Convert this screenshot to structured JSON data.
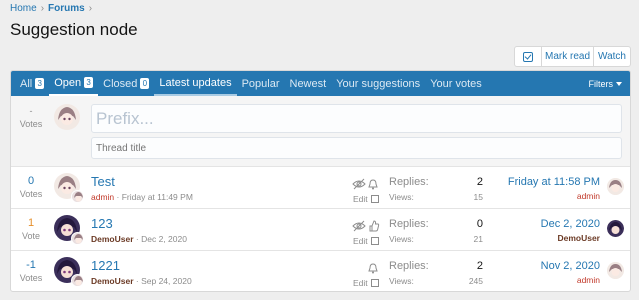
{
  "breadcrumb": {
    "home": "Home",
    "sep": "›",
    "current": "Forums",
    "trail": "›"
  },
  "page_title": "Suggestion node",
  "actions": {
    "mark_read": "Mark read",
    "watch": "Watch"
  },
  "tabs": [
    {
      "label": "All",
      "count": "3"
    },
    {
      "label": "Open",
      "count": "3"
    },
    {
      "label": "Closed",
      "count": "0"
    },
    {
      "label": "Latest updates"
    },
    {
      "label": "Popular"
    },
    {
      "label": "Newest"
    },
    {
      "label": "Your suggestions"
    },
    {
      "label": "Your votes"
    }
  ],
  "filters_label": "Filters",
  "quick_thread": {
    "votes_num": "-",
    "votes_label": "Votes",
    "prefix_placeholder": "Prefix...",
    "title_placeholder": "Thread title"
  },
  "threads": [
    {
      "votes": "0",
      "votes_label": "Votes",
      "title": "Test",
      "author": "admin",
      "sep": " · ",
      "date": "Friday at 11:49 PM",
      "edit": "Edit",
      "replies_label": "Replies:",
      "replies": "2",
      "views_label": "Views:",
      "views": "15",
      "last_date": "Friday at 11:58 PM",
      "last_user": "admin"
    },
    {
      "votes": "1",
      "votes_label": "Vote",
      "title": "123",
      "author": "DemoUser",
      "sep": " · ",
      "date": "Dec 2, 2020",
      "edit": "Edit",
      "replies_label": "Replies:",
      "replies": "0",
      "views_label": "Views:",
      "views": "21",
      "last_date": "Dec 2, 2020",
      "last_user": "DemoUser"
    },
    {
      "votes": "-1",
      "votes_label": "Votes",
      "title": "1221",
      "author": "DemoUser",
      "sep": " · ",
      "date": "Sep 24, 2020",
      "edit": "Edit",
      "replies_label": "Replies:",
      "replies": "2",
      "views_label": "Views:",
      "views": "245",
      "last_date": "Nov 2, 2020",
      "last_user": "admin"
    }
  ],
  "colors": {
    "accent": "#2577b1",
    "vote_orange": "#e58f2b",
    "admin_red": "#c23a2b",
    "demo_brown": "#6b3a25"
  }
}
